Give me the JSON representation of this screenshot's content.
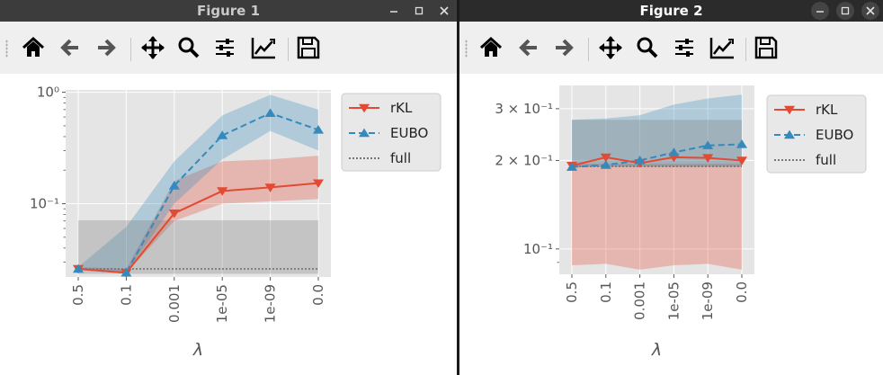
{
  "windows": [
    {
      "title": "Figure 1",
      "toolbar": [
        "home-icon",
        "back-arrow-icon",
        "forward-arrow-icon",
        "pan-icon",
        "zoom-icon",
        "configure-subplots-icon",
        "edit-axis-icon",
        "save-icon"
      ]
    },
    {
      "title": "Figure 2",
      "toolbar": [
        "home-icon",
        "back-arrow-icon",
        "forward-arrow-icon",
        "pan-icon",
        "zoom-icon",
        "configure-subplots-icon",
        "edit-axis-icon",
        "save-icon"
      ]
    }
  ],
  "colors": {
    "rkl": "#e24a33",
    "eubo": "#348abd",
    "full": "#777777",
    "axes_bg": "#e5e5e5"
  },
  "chart_data": [
    {
      "type": "line",
      "categories": [
        "0.5",
        "0.1",
        "0.001",
        "1e-05",
        "1e-09",
        "0.0"
      ],
      "xlabel": "λ",
      "ylabel": "",
      "yscale": "log",
      "ylim": [
        0.022,
        1.05
      ],
      "yticks": [
        {
          "value": 0.1,
          "label": "10⁻¹"
        },
        {
          "value": 1.0,
          "label": "10⁰"
        }
      ],
      "grid": true,
      "legend_placement": "upper right, outside",
      "series": [
        {
          "name": "rKL",
          "style": "solid",
          "marker": "down-triangle",
          "color": "#e24a33",
          "values": [
            0.026,
            0.024,
            0.082,
            0.13,
            0.14,
            0.153
          ],
          "lower": [
            0.026,
            0.024,
            0.07,
            0.1,
            0.105,
            0.11
          ],
          "upper": [
            0.027,
            0.026,
            0.16,
            0.24,
            0.25,
            0.27
          ]
        },
        {
          "name": "EUBO",
          "style": "dashed",
          "marker": "up-triangle",
          "color": "#348abd",
          "values": [
            0.026,
            0.024,
            0.145,
            0.41,
            0.65,
            0.46
          ],
          "lower": [
            0.026,
            0.024,
            0.1,
            0.25,
            0.45,
            0.3
          ],
          "upper": [
            0.027,
            0.062,
            0.24,
            0.62,
            0.95,
            0.7
          ]
        },
        {
          "name": "full",
          "style": "dotted",
          "marker": "none",
          "color": "#777777",
          "values": [
            0.026,
            0.026,
            0.026,
            0.026,
            0.026,
            0.026
          ],
          "lower": [
            0.0235,
            0.0235,
            0.0235,
            0.0235,
            0.0235,
            0.0235
          ],
          "upper": [
            0.071,
            0.071,
            0.071,
            0.071,
            0.071,
            0.071
          ]
        }
      ]
    },
    {
      "type": "line",
      "categories": [
        "0.5",
        "0.1",
        "0.001",
        "1e-05",
        "1e-09",
        "0.0"
      ],
      "xlabel": "λ",
      "ylabel": "",
      "yscale": "log",
      "ylim": [
        0.082,
        0.36
      ],
      "yticks": [
        {
          "value": 0.1,
          "label": "10⁻¹"
        },
        {
          "value": 0.2,
          "label": "2 × 10⁻¹"
        },
        {
          "value": 0.3,
          "label": "3 × 10⁻¹"
        }
      ],
      "grid": true,
      "legend_placement": "upper right, outside",
      "series": [
        {
          "name": "rKL",
          "style": "solid",
          "marker": "down-triangle",
          "color": "#e24a33",
          "values": [
            0.192,
            0.205,
            0.196,
            0.205,
            0.204,
            0.2
          ],
          "lower": [
            0.088,
            0.089,
            0.085,
            0.088,
            0.089,
            0.085
          ],
          "upper": [
            0.195,
            0.195,
            0.195,
            0.195,
            0.195,
            0.195
          ]
        },
        {
          "name": "EUBO",
          "style": "dashed",
          "marker": "up-triangle",
          "color": "#348abd",
          "values": [
            0.19,
            0.193,
            0.2,
            0.213,
            0.225,
            0.227
          ],
          "lower": [
            0.19,
            0.19,
            0.19,
            0.19,
            0.19,
            0.19
          ],
          "upper": [
            0.275,
            0.278,
            0.285,
            0.31,
            0.325,
            0.335
          ]
        },
        {
          "name": "full",
          "style": "dotted",
          "marker": "none",
          "color": "#777777",
          "values": [
            0.191,
            0.191,
            0.191,
            0.191,
            0.191,
            0.191
          ],
          "lower": [
            0.191,
            0.191,
            0.191,
            0.191,
            0.191,
            0.191
          ],
          "upper": [
            0.275,
            0.275,
            0.275,
            0.275,
            0.275,
            0.275
          ]
        }
      ]
    }
  ]
}
